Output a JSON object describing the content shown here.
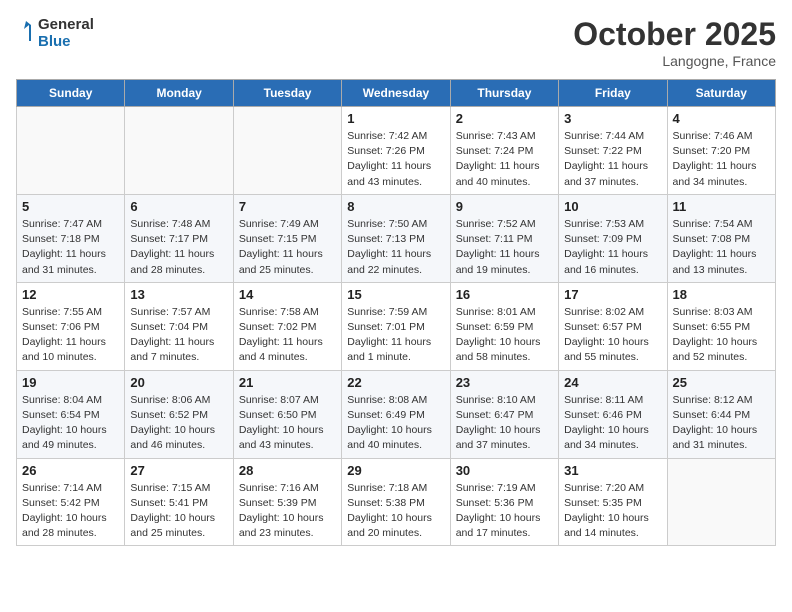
{
  "header": {
    "logo_line1": "General",
    "logo_line2": "Blue",
    "month": "October 2025",
    "location": "Langogne, France"
  },
  "weekdays": [
    "Sunday",
    "Monday",
    "Tuesday",
    "Wednesday",
    "Thursday",
    "Friday",
    "Saturday"
  ],
  "weeks": [
    [
      {
        "day": "",
        "info": ""
      },
      {
        "day": "",
        "info": ""
      },
      {
        "day": "",
        "info": ""
      },
      {
        "day": "1",
        "info": "Sunrise: 7:42 AM\nSunset: 7:26 PM\nDaylight: 11 hours and 43 minutes."
      },
      {
        "day": "2",
        "info": "Sunrise: 7:43 AM\nSunset: 7:24 PM\nDaylight: 11 hours and 40 minutes."
      },
      {
        "day": "3",
        "info": "Sunrise: 7:44 AM\nSunset: 7:22 PM\nDaylight: 11 hours and 37 minutes."
      },
      {
        "day": "4",
        "info": "Sunrise: 7:46 AM\nSunset: 7:20 PM\nDaylight: 11 hours and 34 minutes."
      }
    ],
    [
      {
        "day": "5",
        "info": "Sunrise: 7:47 AM\nSunset: 7:18 PM\nDaylight: 11 hours and 31 minutes."
      },
      {
        "day": "6",
        "info": "Sunrise: 7:48 AM\nSunset: 7:17 PM\nDaylight: 11 hours and 28 minutes."
      },
      {
        "day": "7",
        "info": "Sunrise: 7:49 AM\nSunset: 7:15 PM\nDaylight: 11 hours and 25 minutes."
      },
      {
        "day": "8",
        "info": "Sunrise: 7:50 AM\nSunset: 7:13 PM\nDaylight: 11 hours and 22 minutes."
      },
      {
        "day": "9",
        "info": "Sunrise: 7:52 AM\nSunset: 7:11 PM\nDaylight: 11 hours and 19 minutes."
      },
      {
        "day": "10",
        "info": "Sunrise: 7:53 AM\nSunset: 7:09 PM\nDaylight: 11 hours and 16 minutes."
      },
      {
        "day": "11",
        "info": "Sunrise: 7:54 AM\nSunset: 7:08 PM\nDaylight: 11 hours and 13 minutes."
      }
    ],
    [
      {
        "day": "12",
        "info": "Sunrise: 7:55 AM\nSunset: 7:06 PM\nDaylight: 11 hours and 10 minutes."
      },
      {
        "day": "13",
        "info": "Sunrise: 7:57 AM\nSunset: 7:04 PM\nDaylight: 11 hours and 7 minutes."
      },
      {
        "day": "14",
        "info": "Sunrise: 7:58 AM\nSunset: 7:02 PM\nDaylight: 11 hours and 4 minutes."
      },
      {
        "day": "15",
        "info": "Sunrise: 7:59 AM\nSunset: 7:01 PM\nDaylight: 11 hours and 1 minute."
      },
      {
        "day": "16",
        "info": "Sunrise: 8:01 AM\nSunset: 6:59 PM\nDaylight: 10 hours and 58 minutes."
      },
      {
        "day": "17",
        "info": "Sunrise: 8:02 AM\nSunset: 6:57 PM\nDaylight: 10 hours and 55 minutes."
      },
      {
        "day": "18",
        "info": "Sunrise: 8:03 AM\nSunset: 6:55 PM\nDaylight: 10 hours and 52 minutes."
      }
    ],
    [
      {
        "day": "19",
        "info": "Sunrise: 8:04 AM\nSunset: 6:54 PM\nDaylight: 10 hours and 49 minutes."
      },
      {
        "day": "20",
        "info": "Sunrise: 8:06 AM\nSunset: 6:52 PM\nDaylight: 10 hours and 46 minutes."
      },
      {
        "day": "21",
        "info": "Sunrise: 8:07 AM\nSunset: 6:50 PM\nDaylight: 10 hours and 43 minutes."
      },
      {
        "day": "22",
        "info": "Sunrise: 8:08 AM\nSunset: 6:49 PM\nDaylight: 10 hours and 40 minutes."
      },
      {
        "day": "23",
        "info": "Sunrise: 8:10 AM\nSunset: 6:47 PM\nDaylight: 10 hours and 37 minutes."
      },
      {
        "day": "24",
        "info": "Sunrise: 8:11 AM\nSunset: 6:46 PM\nDaylight: 10 hours and 34 minutes."
      },
      {
        "day": "25",
        "info": "Sunrise: 8:12 AM\nSunset: 6:44 PM\nDaylight: 10 hours and 31 minutes."
      }
    ],
    [
      {
        "day": "26",
        "info": "Sunrise: 7:14 AM\nSunset: 5:42 PM\nDaylight: 10 hours and 28 minutes."
      },
      {
        "day": "27",
        "info": "Sunrise: 7:15 AM\nSunset: 5:41 PM\nDaylight: 10 hours and 25 minutes."
      },
      {
        "day": "28",
        "info": "Sunrise: 7:16 AM\nSunset: 5:39 PM\nDaylight: 10 hours and 23 minutes."
      },
      {
        "day": "29",
        "info": "Sunrise: 7:18 AM\nSunset: 5:38 PM\nDaylight: 10 hours and 20 minutes."
      },
      {
        "day": "30",
        "info": "Sunrise: 7:19 AM\nSunset: 5:36 PM\nDaylight: 10 hours and 17 minutes."
      },
      {
        "day": "31",
        "info": "Sunrise: 7:20 AM\nSunset: 5:35 PM\nDaylight: 10 hours and 14 minutes."
      },
      {
        "day": "",
        "info": ""
      }
    ]
  ]
}
